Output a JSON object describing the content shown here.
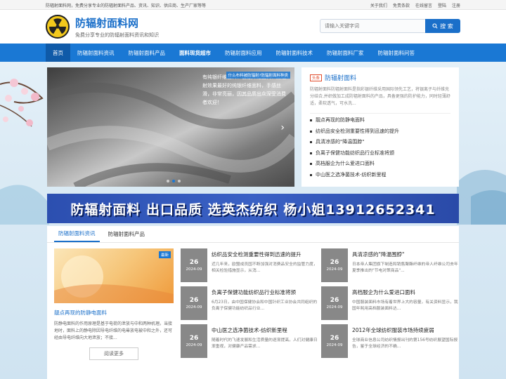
{
  "topbar": {
    "notice": "防辐射面料网，免费分享专业的防辐射面料产品、资讯、知识、供应商、生产厂家等等",
    "links": [
      "关于我们",
      "免责条款",
      "在线留言",
      "登陆",
      "注册"
    ]
  },
  "brand": {
    "name": "防辐射面料网",
    "slogan": "免费分享专业的防辐射面料资讯和知识"
  },
  "search": {
    "placeholder": "请输入关键字词",
    "button_label": "搜 索"
  },
  "nav": {
    "items": [
      "首页",
      "防辐射面料资讯",
      "防辐射面料产品",
      "面料现货超市",
      "防辐射面料应用",
      "防辐射面料技术",
      "防辐射面料厂家",
      "防辐射面料问答"
    ]
  },
  "slider": {
    "tag": "什么布料被防辐射?防辐射面料种类",
    "caption": "有纯银纤维面料、镀银纤维面料、防辐射效果最好的纯银纤维面料，手感丝滑，非常亮丽，因其品质出众深受消费者欢迎！",
    "arrow": "›"
  },
  "side_news": {
    "tag": "头条",
    "title": "防辐射面料",
    "desc": "防辐射面料防辐射面料是指彩银纤维采用国际领先工艺，将银离子与纤维充分结合,并织做加工成防辐射面料的产品，具备更强的防护能力，同时轻薄舒适，柔软透气，可水洗...",
    "items": [
      "靓点再现的防静电面料",
      "纺织品安全检测重要性得到迅速的提升",
      "具清凉感的\"降温围脖\"",
      "负离子保健功能纺织品行业标准将颁",
      "高档服企为什么爱进口面料",
      "中山医之选净菌技术-纺织新里程"
    ]
  },
  "banner": {
    "text": "防辐射面料 出口品质 选英杰纺织 杨小姐13912652341"
  },
  "tabs": [
    "防辐射面料资讯",
    "防辐射面料产品"
  ],
  "feature": {
    "badge": "最新",
    "title": "靓点再现的防静电面料",
    "desc": "防静电面料的作用原理是基于电荷的泄放与中和两种机理。当接地时，面料上的静电除因导电纤维的电晕放电被中和之外，还可经由导电纤维向大地泄放；不接...",
    "more": "阅读更多"
  },
  "news_cards": [
    {
      "day": "26",
      "ym": "2024-09",
      "title": "纺织品安全检测重要性得到迅速的提升",
      "desc": "近几年来，欧盟成员国不断加强对消费品安全的监管力度，相关检验措施显示，从消..."
    },
    {
      "day": "26",
      "ym": "2024-09",
      "title": "具清凉感的\"降温围脖\"",
      "desc": "日本帝人集团旗下制造和销售聚酯纤维的帝人纤维公司去年夏季推出的\"节电对策商品\"..."
    },
    {
      "day": "26",
      "ym": "2024-09",
      "title": "负离子保健功能纺织品行业标准将颁",
      "desc": "6月23日，由中国保健协会和中国针织工业协会共同组织的负离子保健功能纺织品行业..."
    },
    {
      "day": "26",
      "ym": "2024-09",
      "title": "高档服企为什么爱进口面料",
      "desc": "中国服装面料市场有着世界上大的容量，有关资料显示，我国年耗用高档服装面料达..."
    },
    {
      "day": "26",
      "ym": "2024-09",
      "title": "中山医之选净菌技术-纺织新里程",
      "desc": "随着时代的飞速发展和生活质量的逐渐提高，人们对健康日渐重视，对健康产品需求..."
    },
    {
      "day": "26",
      "ym": "2024-09",
      "title": "2012年全球纺织服装市场持续疲弱",
      "desc": "全球商业信息公司纺织情报出刊的第156号纺织展望国际报告，鉴于全球经济的不确..."
    }
  ]
}
